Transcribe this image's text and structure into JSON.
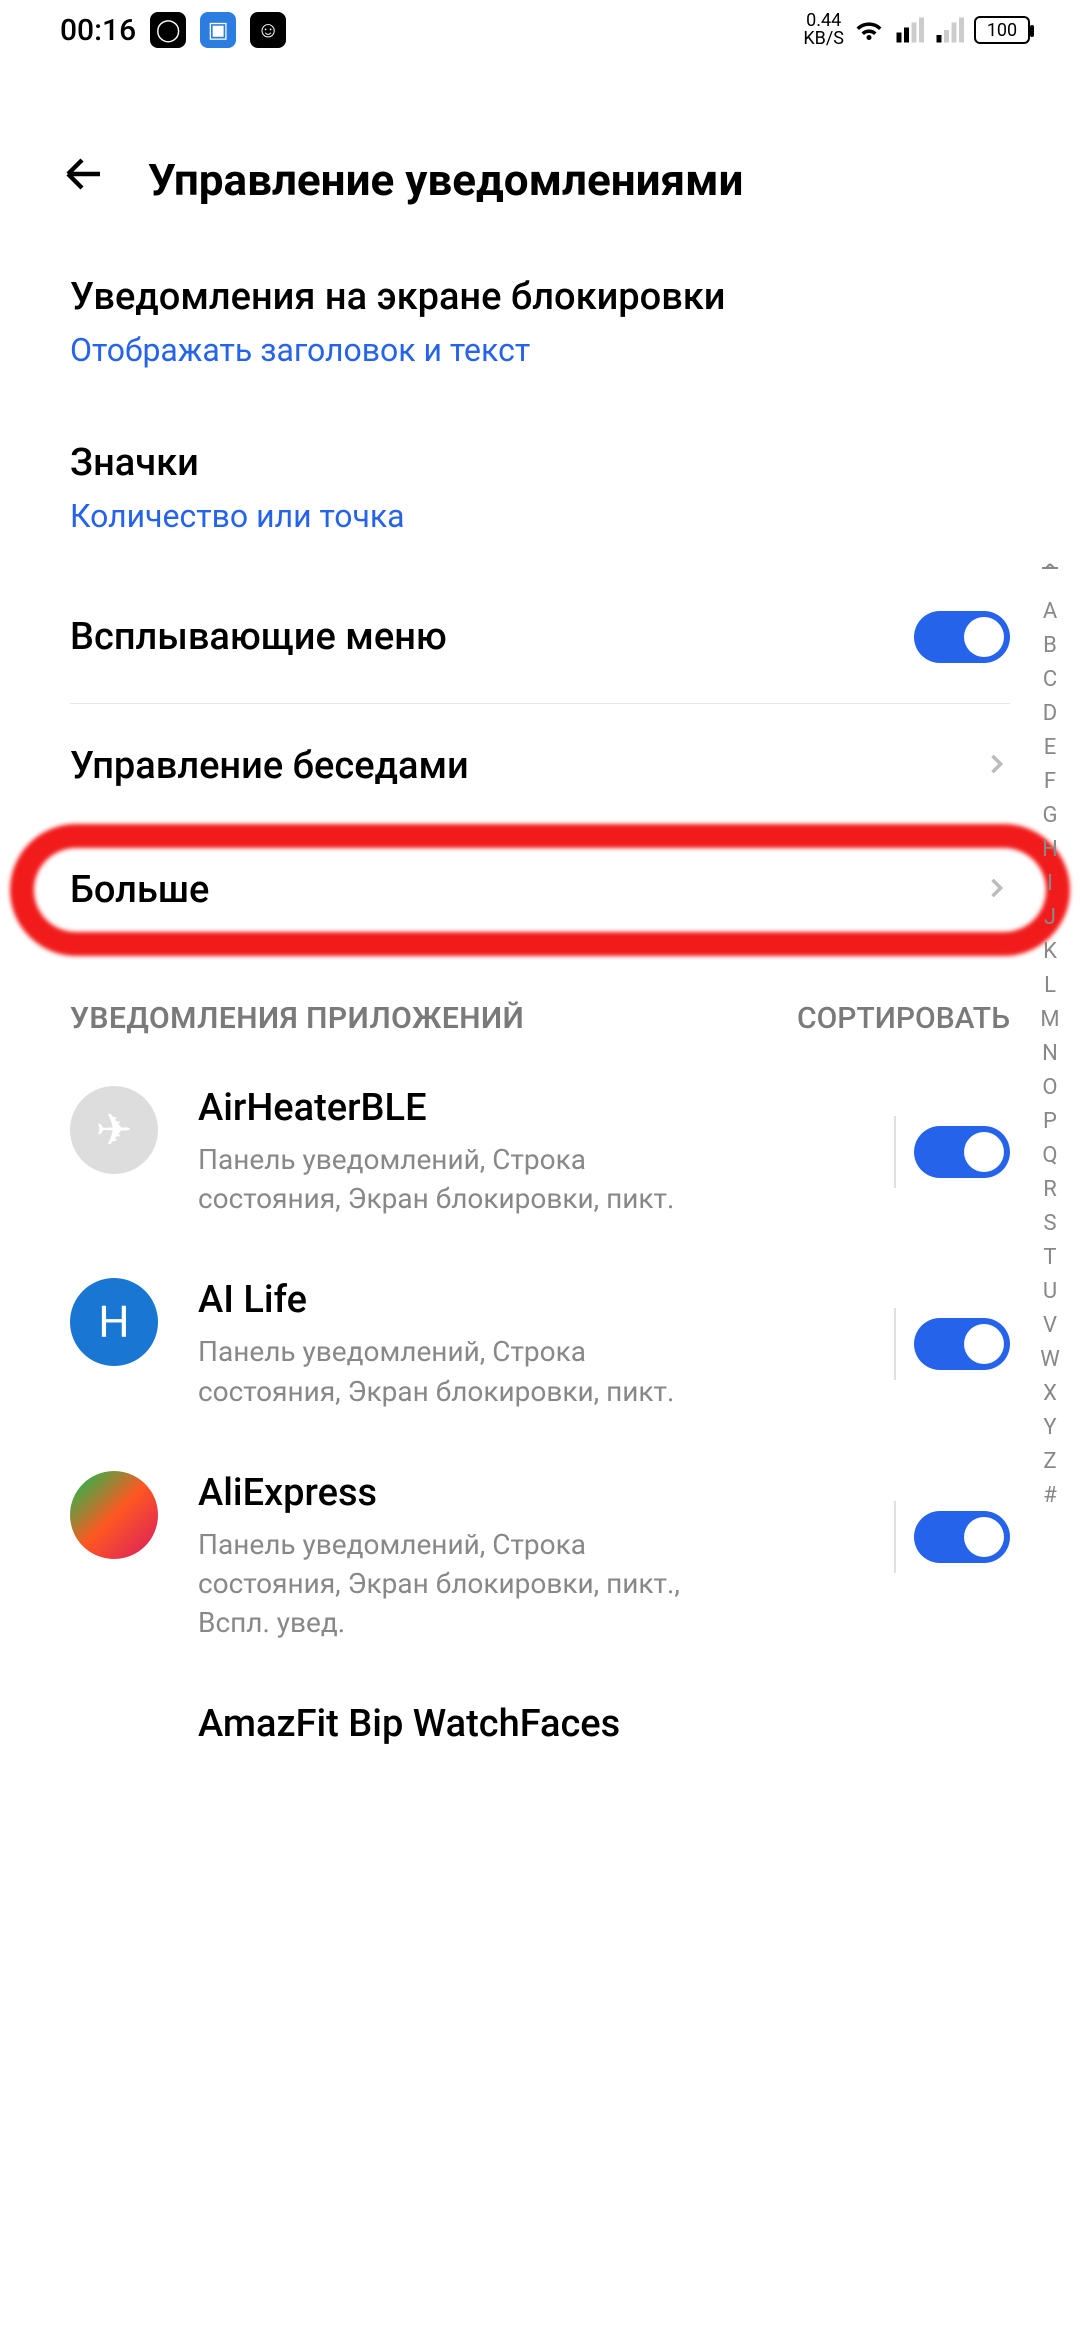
{
  "statusBar": {
    "time": "00:16",
    "kbsValue": "0.44",
    "kbsUnit": "KB/S",
    "battery": "100"
  },
  "header": {
    "title": "Управление уведомлениями"
  },
  "sections": {
    "lockscreen": {
      "title": "Уведомления на экране блокировки",
      "subtitle": "Отображать заголовок и текст"
    },
    "badges": {
      "title": "Значки",
      "subtitle": "Количество или точка"
    },
    "popup": {
      "label": "Всплывающие меню"
    },
    "conversations": {
      "label": "Управление беседами"
    },
    "more": {
      "label": "Больше"
    }
  },
  "appList": {
    "headerLabel": "УВЕДОМЛЕНИЯ ПРИЛОЖЕНИЙ",
    "sortLabel": "СОРТИРОВАТЬ",
    "apps": [
      {
        "name": "AirHeaterBLE",
        "desc": "Панель уведомлений, Строка состояния, Экран блокировки, пикт."
      },
      {
        "name": "AI Life",
        "desc": "Панель уведомлений, Строка состояния, Экран блокировки, пикт."
      },
      {
        "name": "AliExpress",
        "desc": "Панель уведомлений, Строка состояния, Экран блокировки, пикт., Вспл. увед."
      }
    ],
    "partialApp": "AmazFit Bip WatchFaces"
  },
  "alphaIndex": [
    "A",
    "B",
    "C",
    "D",
    "E",
    "F",
    "G",
    "H",
    "I",
    "J",
    "K",
    "L",
    "M",
    "N",
    "O",
    "P",
    "Q",
    "R",
    "S",
    "T",
    "U",
    "V",
    "W",
    "X",
    "Y",
    "Z",
    "#"
  ]
}
